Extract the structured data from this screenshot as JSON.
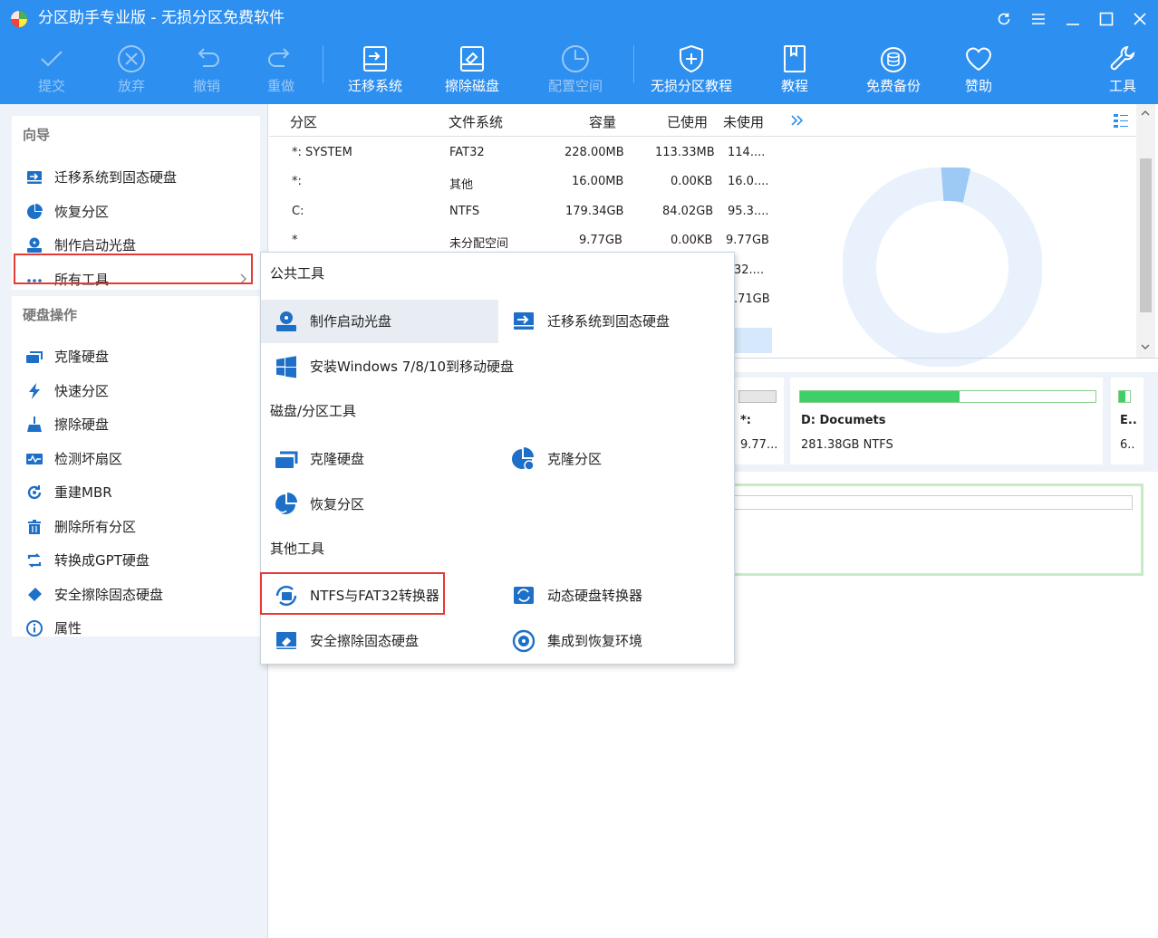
{
  "window": {
    "title": "分区助手专业版 - 无损分区免费软件"
  },
  "toolbar": [
    {
      "label": "提交",
      "icon": "check-icon",
      "enabled": false
    },
    {
      "label": "放弃",
      "icon": "cancel-circle-icon",
      "enabled": false
    },
    {
      "label": "撤销",
      "icon": "undo-icon",
      "enabled": false
    },
    {
      "label": "重做",
      "icon": "redo-icon",
      "enabled": false
    },
    {
      "label": "迁移系统",
      "icon": "migrate-disk-icon",
      "enabled": true
    },
    {
      "label": "擦除磁盘",
      "icon": "wipe-disk-icon",
      "enabled": true
    },
    {
      "label": "配置空间",
      "icon": "pie-clock-icon",
      "enabled": false
    },
    {
      "label": "无损分区教程",
      "icon": "shield-plus-icon",
      "enabled": true
    },
    {
      "label": "教程",
      "icon": "book-icon",
      "enabled": true
    },
    {
      "label": "免费备份",
      "icon": "backup-icon",
      "enabled": true
    },
    {
      "label": "赞助",
      "icon": "heart-icon",
      "enabled": true
    },
    {
      "label": "工具",
      "icon": "wrench-icon",
      "enabled": true
    }
  ],
  "sidebar": {
    "guide_title": "向导",
    "guide_items": [
      {
        "label": "迁移系统到固态硬盘",
        "icon": "migrate-ssd-icon"
      },
      {
        "label": "恢复分区",
        "icon": "recover-partition-icon"
      },
      {
        "label": "制作启动光盘",
        "icon": "boot-disc-icon"
      },
      {
        "label": "所有工具",
        "icon": "more-dots-icon"
      }
    ],
    "disk_title": "硬盘操作",
    "disk_items": [
      {
        "label": "克隆硬盘",
        "icon": "clone-disk-icon"
      },
      {
        "label": "快速分区",
        "icon": "lightning-icon"
      },
      {
        "label": "擦除硬盘",
        "icon": "broom-icon"
      },
      {
        "label": "检测坏扇区",
        "icon": "disk-check-icon"
      },
      {
        "label": "重建MBR",
        "icon": "rebuild-mbr-icon"
      },
      {
        "label": "删除所有分区",
        "icon": "trash-icon"
      },
      {
        "label": "转换成GPT硬盘",
        "icon": "convert-icon"
      },
      {
        "label": "安全擦除固态硬盘",
        "icon": "eraser-icon"
      },
      {
        "label": "属性",
        "icon": "info-icon"
      }
    ]
  },
  "table": {
    "columns": [
      "分区",
      "文件系统",
      "容量",
      "已使用",
      "未使用"
    ],
    "rows": [
      [
        "*: SYSTEM",
        "FAT32",
        "228.00MB",
        "113.33MB",
        "114...."
      ],
      [
        "*:",
        "其他",
        "16.00MB",
        "0.00KB",
        "16.0...."
      ],
      [
        "C:",
        "NTFS",
        "179.34GB",
        "84.02GB",
        "95.3...."
      ],
      [
        "*",
        "未分配空间",
        "9.77GB",
        "0.00KB",
        "9.77GB"
      ],
      [
        "",
        "",
        "",
        "",
        "32...."
      ],
      [
        "",
        "",
        "",
        "",
        ".71GB"
      ]
    ]
  },
  "disk_map": {
    "partitions": [
      {
        "label": "*:",
        "info": "9.77...",
        "fill": 0.0
      },
      {
        "label": "D: Documets",
        "info": "281.38GB NTFS",
        "fill": 0.54
      },
      {
        "label": "E..",
        "info": "6..",
        "fill": 0.6
      }
    ]
  },
  "dropdown": {
    "sections": [
      {
        "title": "公共工具",
        "items": [
          {
            "label": "制作启动光盘",
            "icon": "boot-disc-icon"
          },
          {
            "label": "迁移系统到固态硬盘",
            "icon": "migrate-ssd-icon"
          },
          {
            "label": "安装Windows 7/8/10到移动硬盘",
            "icon": "windows-logo-icon"
          }
        ]
      },
      {
        "title": "磁盘/分区工具",
        "items": [
          {
            "label": "克隆硬盘",
            "icon": "clone-disk-icon"
          },
          {
            "label": "克隆分区",
            "icon": "clone-partition-icon"
          },
          {
            "label": "恢复分区",
            "icon": "recover-partition-icon"
          }
        ]
      },
      {
        "title": "其他工具",
        "items": [
          {
            "label": "NTFS与FAT32转换器",
            "icon": "ntfs-fat32-converter-icon"
          },
          {
            "label": "动态硬盘转换器",
            "icon": "dynamic-disk-converter-icon"
          },
          {
            "label": "安全擦除固态硬盘",
            "icon": "eraser-icon"
          },
          {
            "label": "集成到恢复环境",
            "icon": "recovery-env-icon"
          }
        ]
      }
    ]
  },
  "colors": {
    "accent": "#2d8ff0",
    "highlight_box": "#e53935",
    "used_bar": "#3ecf6a",
    "chart": "#9ccaf5"
  }
}
